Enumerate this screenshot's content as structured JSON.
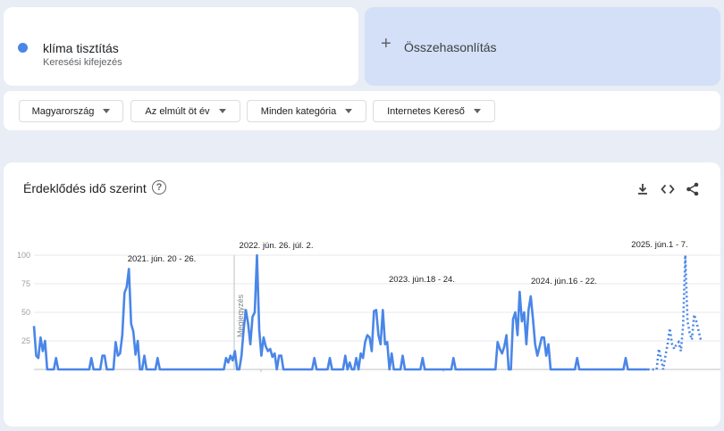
{
  "search_term": {
    "name": "klíma tisztítás",
    "type": "Keresési kifejezés",
    "color": "#4a86e8"
  },
  "compare": {
    "label": "Összehasonlítás"
  },
  "filters": [
    {
      "label": "Magyarország"
    },
    {
      "label": "Az elmúlt öt év"
    },
    {
      "label": "Minden kategória"
    },
    {
      "label": "Internetes Kereső"
    }
  ],
  "chart_card": {
    "title": "Érdeklődés idő szerint",
    "icons": [
      "help-icon",
      "download-icon",
      "embed-icon",
      "share-icon"
    ]
  },
  "chart_data": {
    "type": "line",
    "ylim": [
      0,
      100
    ],
    "y_ticks": [
      "100",
      "75",
      "50",
      "25"
    ],
    "note": "Megjegyzés",
    "series_color": "#4a86e8",
    "values": [
      38,
      12,
      10,
      28,
      16,
      25,
      0,
      0,
      0,
      0,
      10,
      0,
      0,
      0,
      0,
      0,
      0,
      0,
      0,
      0,
      0,
      0,
      0,
      0,
      0,
      0,
      10,
      0,
      0,
      0,
      0,
      12,
      12,
      0,
      0,
      0,
      0,
      24,
      12,
      14,
      30,
      67,
      72,
      88,
      40,
      33,
      13,
      25,
      0,
      0,
      12,
      0,
      0,
      0,
      0,
      0,
      10,
      0,
      0,
      0,
      0,
      0,
      0,
      0,
      0,
      0,
      0,
      0,
      0,
      0,
      0,
      0,
      0,
      0,
      0,
      0,
      0,
      0,
      0,
      0,
      0,
      0,
      0,
      0,
      0,
      0,
      0,
      10,
      6,
      12,
      8,
      16,
      0,
      0,
      12,
      36,
      52,
      40,
      22,
      46,
      50,
      100,
      35,
      12,
      28,
      20,
      16,
      18,
      11,
      14,
      0,
      12,
      12,
      0,
      0,
      0,
      0,
      0,
      0,
      0,
      0,
      0,
      0,
      0,
      0,
      0,
      0,
      10,
      0,
      0,
      0,
      0,
      0,
      0,
      10,
      0,
      0,
      0,
      0,
      0,
      0,
      12,
      0,
      6,
      0,
      0,
      10,
      0,
      14,
      10,
      24,
      30,
      28,
      16,
      51,
      52,
      30,
      22,
      52,
      22,
      24,
      0,
      14,
      0,
      0,
      0,
      0,
      12,
      0,
      0,
      0,
      0,
      0,
      0,
      0,
      0,
      10,
      0,
      0,
      0,
      0,
      0,
      0,
      0,
      0,
      0,
      0,
      0,
      0,
      0,
      10,
      0,
      0,
      0,
      0,
      0,
      0,
      0,
      0,
      0,
      0,
      0,
      0,
      0,
      0,
      0,
      0,
      0,
      0,
      0,
      24,
      18,
      14,
      20,
      30,
      0,
      0,
      44,
      50,
      30,
      68,
      42,
      50,
      22,
      52,
      64,
      44,
      22,
      12,
      20,
      28,
      28,
      12,
      22,
      0,
      0,
      0,
      0,
      0,
      0,
      0,
      0,
      0,
      0,
      0,
      0,
      10,
      0,
      0,
      0,
      0,
      0,
      0,
      0,
      0,
      0,
      0,
      0,
      0,
      0,
      0,
      0,
      0,
      0,
      0,
      0,
      0,
      0,
      10,
      0,
      0,
      0,
      0,
      0,
      0,
      0,
      0,
      0,
      0,
      0,
      0,
      0,
      0,
      18,
      10,
      0,
      12,
      22,
      36,
      22,
      18,
      22,
      24,
      16,
      38,
      100,
      42,
      32,
      26,
      48,
      42,
      34,
      26
    ],
    "partial_from_index": 278,
    "annotations": [
      {
        "label": "2021. jún. 20 - 26.",
        "index": 43
      },
      {
        "label": "2022. jún. 26. júl. 2.",
        "index": 101
      },
      {
        "label": "2023. jún.18 - 24.",
        "index": 160
      },
      {
        "label": "2024. jún.16 - 22.",
        "index": 216
      },
      {
        "label": "2025. jún.1 - 7.",
        "index": 270
      }
    ]
  }
}
